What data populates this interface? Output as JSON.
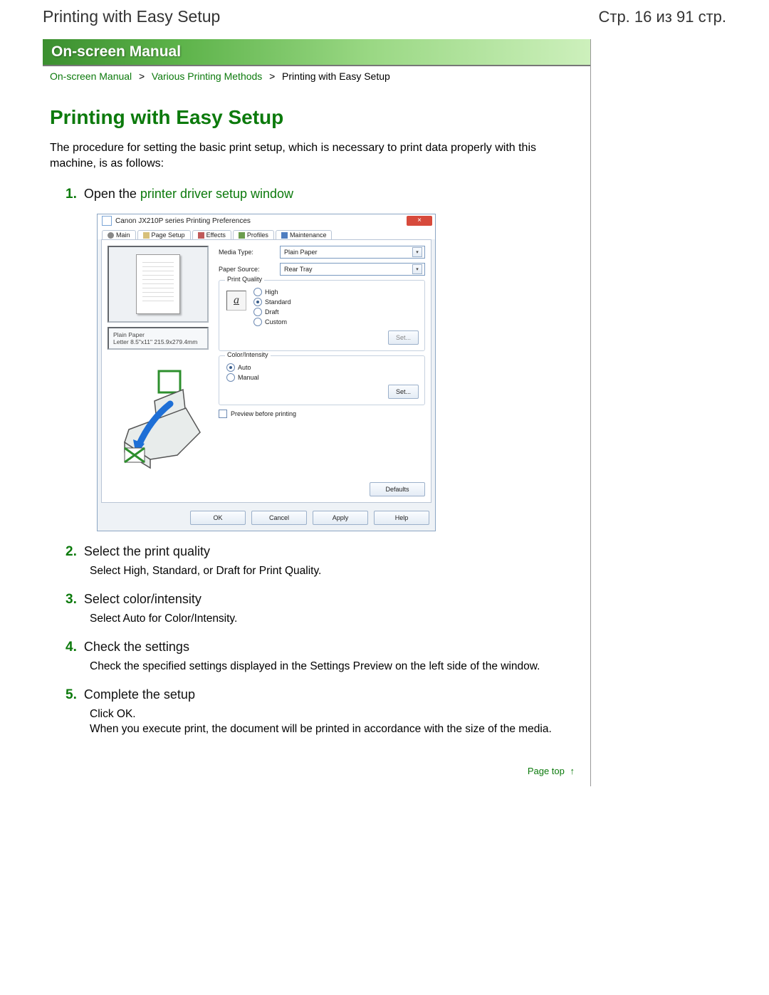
{
  "header": {
    "title_left": "Printing with Easy Setup",
    "title_right": "Стр. 16 из 91 стр."
  },
  "banner": "On-screen Manual",
  "breadcrumb": {
    "item1": "On-screen Manual",
    "item2": "Various Printing Methods",
    "current": "Printing with Easy Setup"
  },
  "page_title": "Printing with Easy Setup",
  "intro": "The procedure for setting the basic print setup, which is necessary to print data properly with this machine, is as follows:",
  "steps": {
    "s1": {
      "num": "1.",
      "title_a": "Open the ",
      "title_b": "printer driver setup window"
    },
    "s2": {
      "num": "2.",
      "title": "Select the print quality",
      "body": "Select High, Standard, or Draft for Print Quality."
    },
    "s3": {
      "num": "3.",
      "title": "Select color/intensity",
      "body": "Select Auto for Color/Intensity."
    },
    "s4": {
      "num": "4.",
      "title": "Check the settings",
      "body": "Check the specified settings displayed in the Settings Preview on the left side of the window."
    },
    "s5": {
      "num": "5.",
      "title": "Complete the setup",
      "body_a": "Click OK.",
      "body_b": "When you execute print, the document will be printed in accordance with the size of the media."
    }
  },
  "page_top": "Page top",
  "dialog": {
    "title": "Canon JX210P series Printing Preferences",
    "close": "×",
    "tabs": {
      "main": "Main",
      "page_setup": "Page Setup",
      "effects": "Effects",
      "profiles": "Profiles",
      "maintenance": "Maintenance"
    },
    "labels": {
      "media_type": "Media Type:",
      "paper_source": "Paper Source:",
      "print_quality_grp": "Print Quality",
      "high": "High",
      "standard": "Standard",
      "draft": "Draft",
      "custom": "Custom",
      "set": "Set...",
      "color_intensity_grp": "Color/Intensity",
      "auto": "Auto",
      "manual": "Manual",
      "preview_before": "Preview before printing",
      "defaults": "Defaults",
      "ok": "OK",
      "cancel": "Cancel",
      "apply": "Apply",
      "help": "Help"
    },
    "values": {
      "media_type": "Plain Paper",
      "paper_source": "Rear Tray",
      "preview_meta_a": "Plain Paper",
      "preview_meta_b": "Letter 8.5\"x11\" 215.9x279.4mm"
    }
  }
}
